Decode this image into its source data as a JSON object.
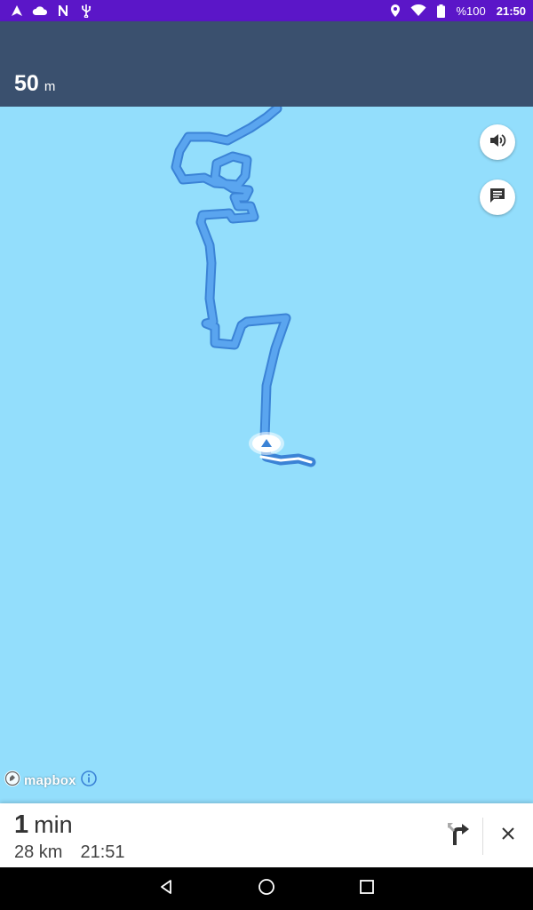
{
  "status_bar": {
    "icons_left": [
      "navigation-arrow-icon",
      "cloud-icon",
      "n-notification-icon",
      "usb-icon"
    ],
    "icons_right": [
      "location-pin-icon",
      "wifi-icon",
      "battery-icon"
    ],
    "battery": "%100",
    "time": "21:50"
  },
  "banner": {
    "distance_value": "50",
    "distance_unit": "m"
  },
  "map": {
    "attribution": "mapbox",
    "route_color": "#5AA5EF",
    "route_outline_color": "#3B83D6"
  },
  "summary": {
    "time_value": "1",
    "time_unit": "min",
    "distance": "28 km",
    "arrival": "21:51"
  },
  "nav": {
    "buttons": [
      "back-icon",
      "home-icon",
      "recents-icon"
    ]
  },
  "colors": {
    "status_bar": "#5B16C8",
    "banner": "#3A506E",
    "map_water": "#93DEFC"
  }
}
